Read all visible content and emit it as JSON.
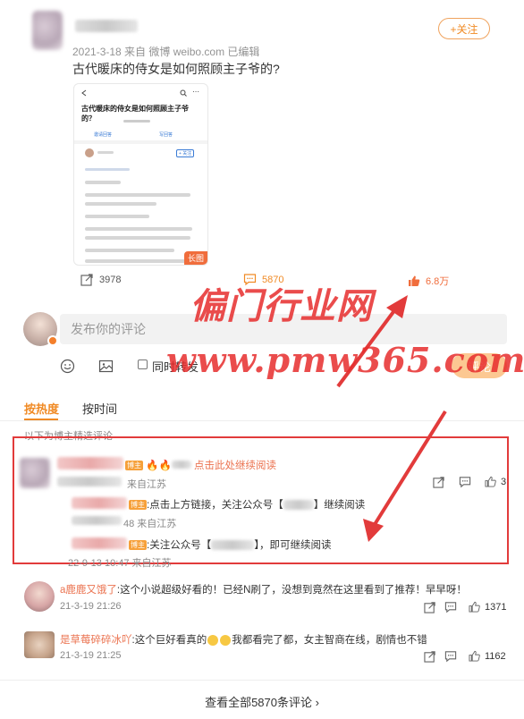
{
  "post": {
    "meta": "2021-3-18  来自 微博 weibo.com 已编辑",
    "title": "古代暖床的侍女是如何照顾主子爷的?",
    "follow_label": "+关注"
  },
  "thumbnail": {
    "title": "古代暖床的侍女是如何照顾主子爷的？",
    "long_badge": "长图",
    "tab1": "邀请回答",
    "tab2": "写回答",
    "follow": "+ 关注"
  },
  "actions": {
    "share_count": "3978",
    "comment_count": "5870",
    "like_count": "6.8万"
  },
  "comment_box": {
    "placeholder": "发布你的评论",
    "repost_label": "同时转发",
    "submit_label": "评论"
  },
  "tabs": {
    "hot": "按热度",
    "time": "按时间"
  },
  "hint": "以下为博主精选评论",
  "featured": {
    "tag": "博主",
    "main_text": "点击此处继续阅读",
    "main_location": "来自江苏",
    "reply1_text": ":点击上方链接，关注公众号【",
    "reply1_suffix": "】继续阅读",
    "reply1_time": "48 来自江苏",
    "reply2_text": ":关注公众号【",
    "reply2_suffix": "】，即可继续阅读",
    "reply2_time": "22-9-13 10:47 来自江苏",
    "right_count": "3"
  },
  "comments": [
    {
      "name": "a鹿鹿又饿了",
      "text": ":这个小说超级好看的！已经N刷了，没想到竟然在这里看到了推荐！早早呀！",
      "time": "21-3-19 21:26",
      "likes": "1371"
    },
    {
      "name": "是草莓碎碎冰吖",
      "text_a": ":这个巨好看真的",
      "text_b": "我都看完了都，女主智商在线，剧情也不错",
      "time": "21-3-19 21:25",
      "likes": "1162"
    }
  ],
  "view_all": "查看全部5870条评论 ›",
  "watermark": {
    "line1": "偏门行业网",
    "line2": "www.pmw365.com"
  },
  "colors": {
    "accent": "#f08a24",
    "frame": "#e23b3b",
    "name": "#eb7350"
  }
}
